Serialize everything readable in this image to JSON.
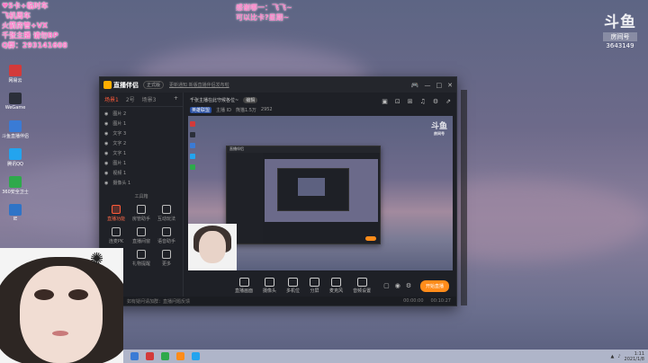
{
  "overlay": {
    "left_lines": [
      "♥5卡+临时车",
      "飞机周车",
      "火箭房管+VX",
      "千张主播 请勿BP",
      "Q群：293141608"
    ],
    "top_lines": [
      "感谢哪一：飞飞~",
      "可以比卡?星期~"
    ]
  },
  "room": {
    "logo": "斗鱼",
    "label": "房间号",
    "number": "3643149"
  },
  "desktop_icons": [
    {
      "label": "网易云",
      "color": "#d33a3a"
    },
    {
      "label": "WeGame",
      "color": "#2b2f3a"
    },
    {
      "label": "斗鱼直播伴侣",
      "color": "#3a7bd5"
    },
    {
      "label": "腾讯QQ",
      "color": "#23a4ee"
    },
    {
      "label": "360安全卫士",
      "color": "#2ea94b"
    },
    {
      "label": "IE",
      "color": "#2f74c7"
    }
  ],
  "app": {
    "name": "直播伴侣",
    "version_pill": "正式版",
    "notice": "更新通知 新版直播伴侣发布啦",
    "titlebar_icons": [
      "🎮",
      "—",
      "□",
      "✕"
    ],
    "sidebar_tabs": [
      "场景1",
      "2号",
      "场景3"
    ],
    "scenes": [
      "图片 2",
      "图片 1",
      "文字 3",
      "文字 2",
      "文字 1",
      "图片 1",
      "视频 1",
      "摄像头 1"
    ],
    "tools_title": "工具箱",
    "tools": [
      {
        "label": "直播功能",
        "hot": true
      },
      {
        "label": "房管助手",
        "hot": false
      },
      {
        "label": "互动玩法",
        "hot": false
      },
      {
        "label": "连麦PK",
        "hot": false
      },
      {
        "label": "直播间窗",
        "hot": false
      },
      {
        "label": "语音助手",
        "hot": false
      },
      {
        "label": "弹幕",
        "hot": false
      },
      {
        "label": "礼物提醒",
        "hot": false
      },
      {
        "label": "更多",
        "hot": false
      },
      {
        "label": "搜索",
        "hot": false
      }
    ],
    "room_title": "千张主播在此守候各位~",
    "edit_label": "编辑",
    "category": "英雄联盟",
    "meta": [
      "主播 ID",
      "熊猫1.5万",
      "2952"
    ],
    "preview_logo": "斗鱼",
    "preview_logo_sub": "房间号",
    "nested_title": "直播伴侣",
    "controls": [
      "直播画面",
      "摄像头",
      "多机位",
      "分屏",
      "麦克风",
      "音频设置"
    ],
    "right_controls": [
      "▢",
      "◉",
      "⚙"
    ],
    "live_button": "开始直播",
    "status_left": "如有疑问请加群：直播问题反馈",
    "status_right": [
      "00:00:00",
      "00:10:27"
    ]
  },
  "taskbar": {
    "icons": [
      "#3a7bd5",
      "#d33a3a",
      "#2ea94b",
      "#ff8c1a",
      "#23a4ee"
    ],
    "time": "1:11",
    "date": "2021/1/8"
  }
}
